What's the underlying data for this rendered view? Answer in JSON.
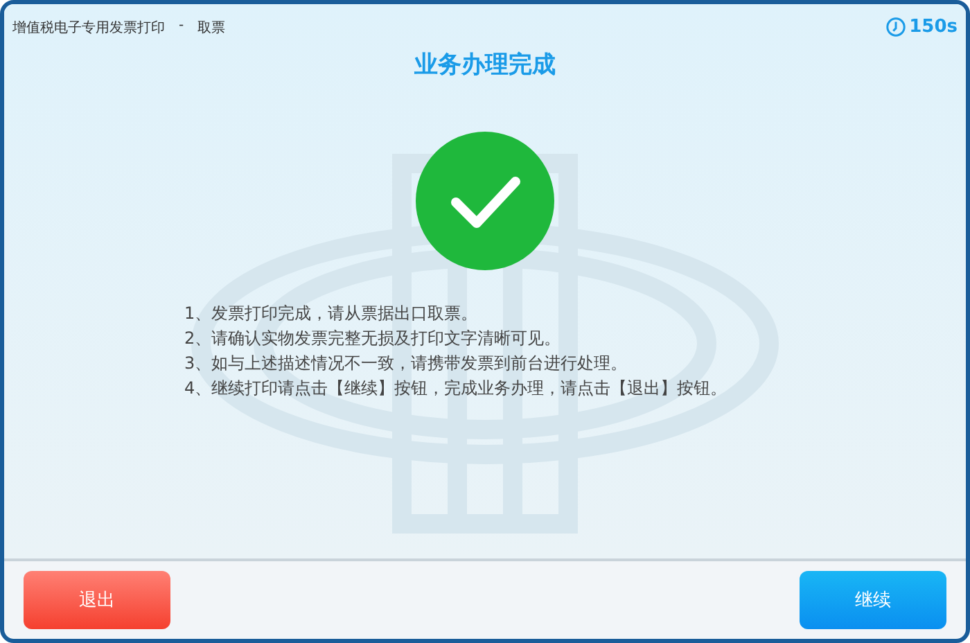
{
  "header": {
    "title": "增值税电子专用发票打印",
    "separator": "-",
    "subtitle": "取票",
    "countdown": "150s"
  },
  "heading": "业务办理完成",
  "status": {
    "kind": "success"
  },
  "instructions": [
    "1、发票打印完成，请从票据出口取票。",
    "2、请确认实物发票完整无损及打印文字清晰可见。",
    "3、如与上述描述情况不一致，请携带发票到前台进行处理。",
    "4、继续打印请点击【继续】按钮，完成业务办理，请点击【退出】按钮。"
  ],
  "buttons": [
    {
      "label": "退出",
      "kind": "danger"
    },
    {
      "label": "继续",
      "kind": "primary"
    }
  ]
}
